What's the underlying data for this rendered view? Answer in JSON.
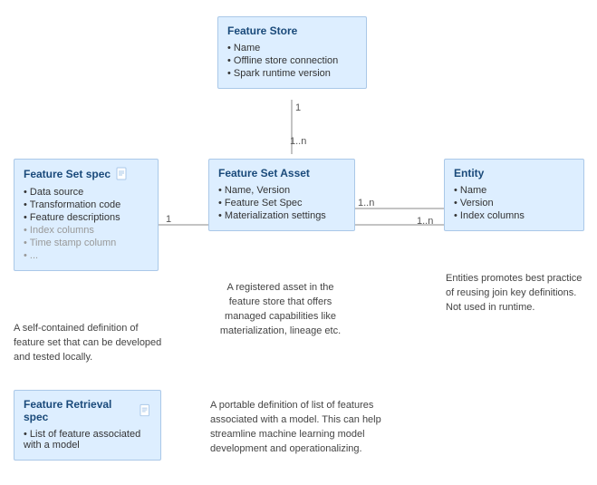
{
  "featureStore": {
    "title": "Feature Store",
    "items": [
      "Name",
      "Offline store connection",
      "Spark runtime version"
    ]
  },
  "featureSetSpec": {
    "title": "Feature Set spec",
    "items": [
      "Data source",
      "Transformation code",
      "Feature descriptions"
    ],
    "faded": [
      "Index columns",
      "Time stamp column",
      "..."
    ],
    "desc": "A self-contained definition of feature set that can be developed and tested locally."
  },
  "featureSetAsset": {
    "title": "Feature Set Asset",
    "items": [
      "Name, Version",
      "Feature Set Spec",
      "Materialization settings"
    ],
    "desc": "A registered asset in the feature store that offers managed capabilities like materialization, lineage etc."
  },
  "entity": {
    "title": "Entity",
    "items": [
      "Name",
      "Version",
      "Index columns"
    ],
    "desc": "Entities promotes best practice of reusing join key definitions. Not used in runtime."
  },
  "featureRetrievalSpec": {
    "title": "Feature Retrieval spec",
    "items": [
      "List of feature associated with a model"
    ],
    "desc": "A portable definition of list of features associated with a model. This can help streamline machine learning model development and operationalizing."
  },
  "labels": {
    "one1": "1",
    "oneN1": "1..n",
    "one2": "1",
    "oneN2": "1..n",
    "oneN3": "1..n"
  }
}
